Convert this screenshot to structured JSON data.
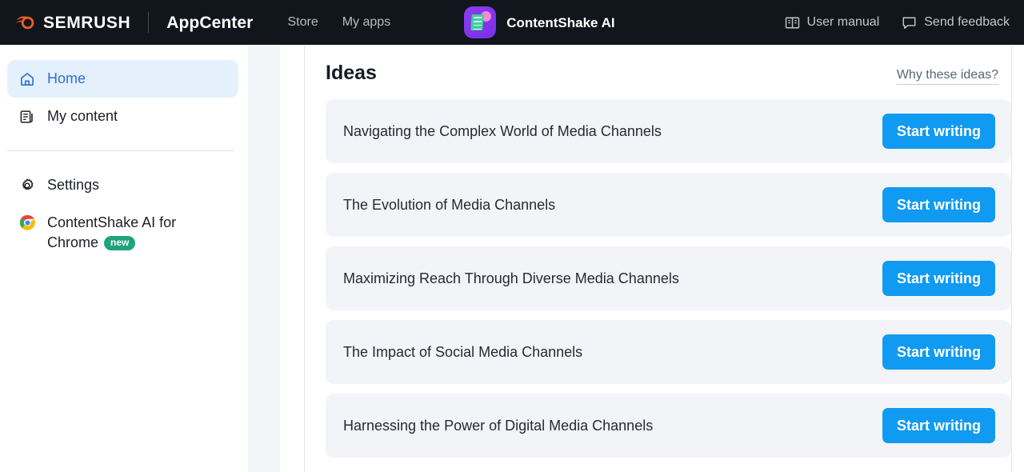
{
  "topbar": {
    "logo_icon": "semrush-comet-logo",
    "brand": "SEMRUSH",
    "product": "AppCenter",
    "nav": [
      {
        "label": "Store",
        "name": "store"
      },
      {
        "label": "My apps",
        "name": "my-apps"
      }
    ],
    "app": {
      "icon": "contentshake-app-icon",
      "name": "ContentShake AI"
    },
    "actions": [
      {
        "label": "User manual",
        "icon": "book-icon",
        "name": "user-manual"
      },
      {
        "label": "Send feedback",
        "icon": "speech-bubble-icon",
        "name": "send-feedback"
      }
    ]
  },
  "sidebar": {
    "items": [
      {
        "label": "Home",
        "icon": "home-icon",
        "active": true
      },
      {
        "label": "My content",
        "icon": "document-icon",
        "active": false
      },
      {
        "label": "Settings",
        "icon": "gear-icon",
        "active": false
      },
      {
        "label": "ContentShake AI for Chrome",
        "icon": "chrome-icon",
        "badge": "new",
        "active": false
      }
    ]
  },
  "main": {
    "heading": "Ideas",
    "why_link": "Why these ideas?",
    "button_label": "Start writing",
    "ideas": [
      {
        "title": "Navigating the Complex World of Media Channels"
      },
      {
        "title": "The Evolution of Media Channels"
      },
      {
        "title": "Maximizing Reach Through Diverse Media Channels"
      },
      {
        "title": "The Impact of Social Media Channels"
      },
      {
        "title": "Harnessing the Power of Digital Media Channels"
      }
    ]
  },
  "colors": {
    "topbar_bg": "#11151c",
    "accent_blue": "#109af1",
    "active_nav_bg": "#e4f1fd",
    "active_nav_text": "#2f6fd0",
    "card_bg": "#f2f4f8",
    "badge_green": "#1fa37b",
    "semrush_orange": "#ef5c26",
    "app_icon_purple": "#8b3df0"
  }
}
